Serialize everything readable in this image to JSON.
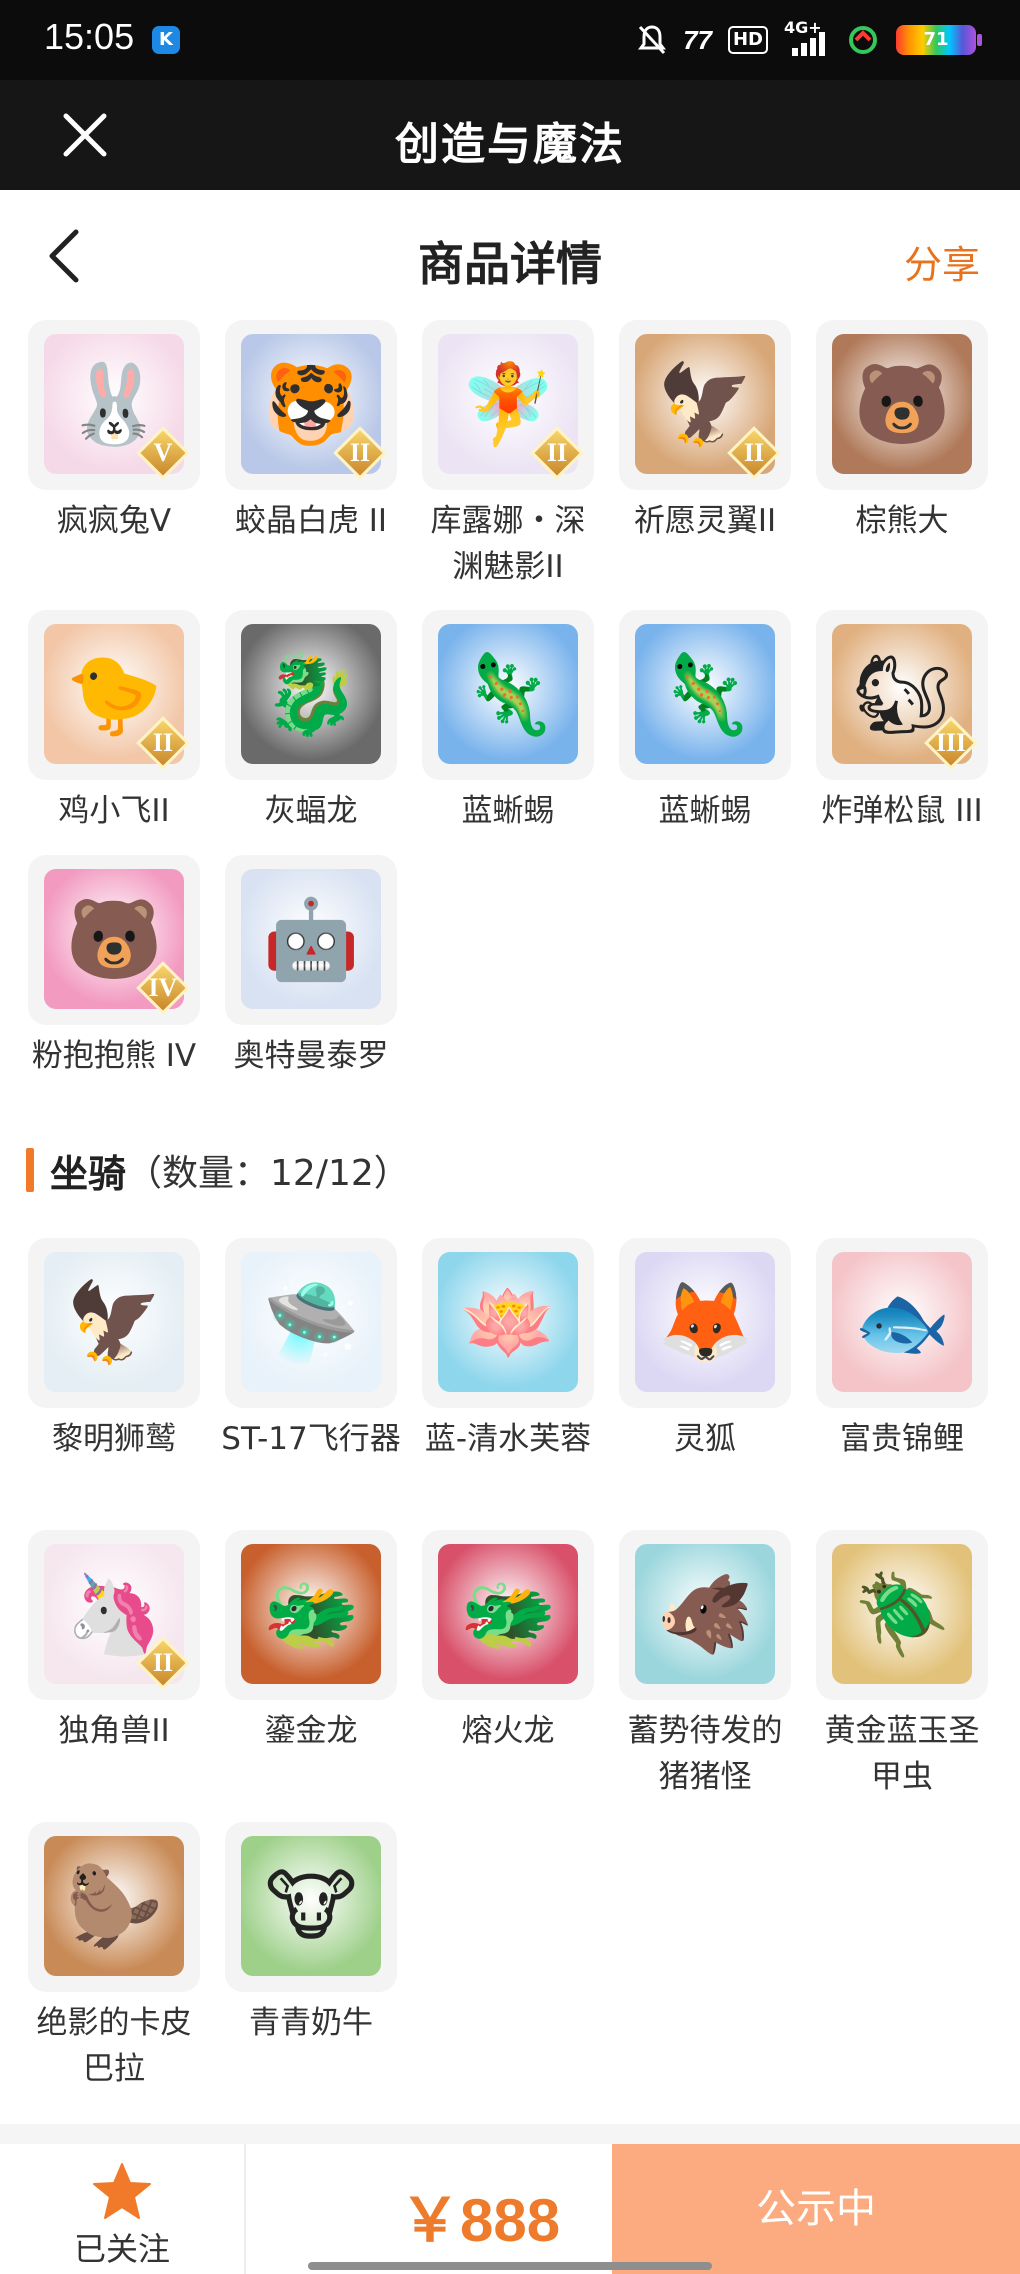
{
  "status_bar": {
    "time": "15:05",
    "app_badge": "K",
    "icons": [
      "mute-bell-icon",
      "network-speed-icon",
      "hd-icon",
      "signal-4g-icon",
      "wifi-icon",
      "battery-icon"
    ],
    "network_text": "77",
    "hd_label": "HD",
    "signal_label": "4G+",
    "battery_level": "71"
  },
  "app_header": {
    "title": "创造与魔法",
    "close_icon": "close-icon"
  },
  "page_nav": {
    "back_icon": "chevron-left-icon",
    "title": "商品详情",
    "share_label": "分享"
  },
  "pets": [
    {
      "name": "疯疯兔V",
      "badge": "V",
      "glyph": "🐰",
      "color": "#f6d9e8"
    },
    {
      "name": "蛟晶白虎 II",
      "badge": "II",
      "glyph": "🐯",
      "color": "#b9c8e8"
    },
    {
      "name": "库露娜・深渊魅影II",
      "badge": "II",
      "glyph": "🧚",
      "color": "#ece4f4"
    },
    {
      "name": "祈愿灵翼II",
      "badge": "II",
      "glyph": "🦅",
      "color": "#d8a778"
    },
    {
      "name": "棕熊大",
      "badge": "",
      "glyph": "🐻",
      "color": "#b07a5a"
    },
    {
      "name": "鸡小飞II",
      "badge": "II",
      "glyph": "🐤",
      "color": "#f2c6a6"
    },
    {
      "name": "灰蝠龙",
      "badge": "",
      "glyph": "🐉",
      "color": "#6a6a6a"
    },
    {
      "name": "蓝蜥蜴",
      "badge": "",
      "glyph": "🦎",
      "color": "#79b3ec"
    },
    {
      "name": "蓝蜥蜴",
      "badge": "",
      "glyph": "🦎",
      "color": "#79b3ec"
    },
    {
      "name": "炸弹松鼠 III",
      "badge": "III",
      "glyph": "🐿",
      "color": "#e0b080"
    },
    {
      "name": "粉抱抱熊 IV",
      "badge": "IV",
      "glyph": "🐻",
      "color": "#f29ac0"
    },
    {
      "name": "奥特曼泰罗",
      "badge": "",
      "glyph": "🤖",
      "color": "#d8e2f2"
    }
  ],
  "mounts_section": {
    "title": "坐骑",
    "count": "（数量：12/12）"
  },
  "mounts": [
    {
      "name": "黎明狮鹫",
      "badge": "",
      "glyph": "🦅",
      "color": "#e4eef4"
    },
    {
      "name": "ST-17飞行器",
      "badge": "",
      "glyph": "🛸",
      "color": "#e8f2fa"
    },
    {
      "name": "蓝-清水芙蓉",
      "badge": "",
      "glyph": "🪷",
      "color": "#8ed6ec"
    },
    {
      "name": "灵狐",
      "badge": "",
      "glyph": "🦊",
      "color": "#dcd8f4"
    },
    {
      "name": "富贵锦鲤",
      "badge": "",
      "glyph": "🐟",
      "color": "#f4c4c8"
    },
    {
      "name": "独角兽II",
      "badge": "II",
      "glyph": "🦄",
      "color": "#f6e6ee"
    },
    {
      "name": "鎏金龙",
      "badge": "",
      "glyph": "🐲",
      "color": "#c8602e"
    },
    {
      "name": "熔火龙",
      "badge": "",
      "glyph": "🐲",
      "color": "#d8506a"
    },
    {
      "name": "蓄势待发的猪猪怪",
      "badge": "",
      "glyph": "🐗",
      "color": "#9ad6dc"
    },
    {
      "name": "黄金蓝玉圣甲虫",
      "badge": "",
      "glyph": "🪲",
      "color": "#e2c27a"
    },
    {
      "name": "绝影的卡皮巴拉",
      "badge": "",
      "glyph": "🦫",
      "color": "#c88a56"
    },
    {
      "name": "青青奶牛",
      "badge": "",
      "glyph": "🐮",
      "color": "#9ed08a"
    }
  ],
  "bottom_bar": {
    "follow_label": "已关注",
    "star_icon": "star-icon",
    "price": "￥888",
    "status_label": "公示中"
  },
  "colors": {
    "accent": "#ee7a2c",
    "status_button": "#fbab7f",
    "header_bg": "#161616"
  }
}
